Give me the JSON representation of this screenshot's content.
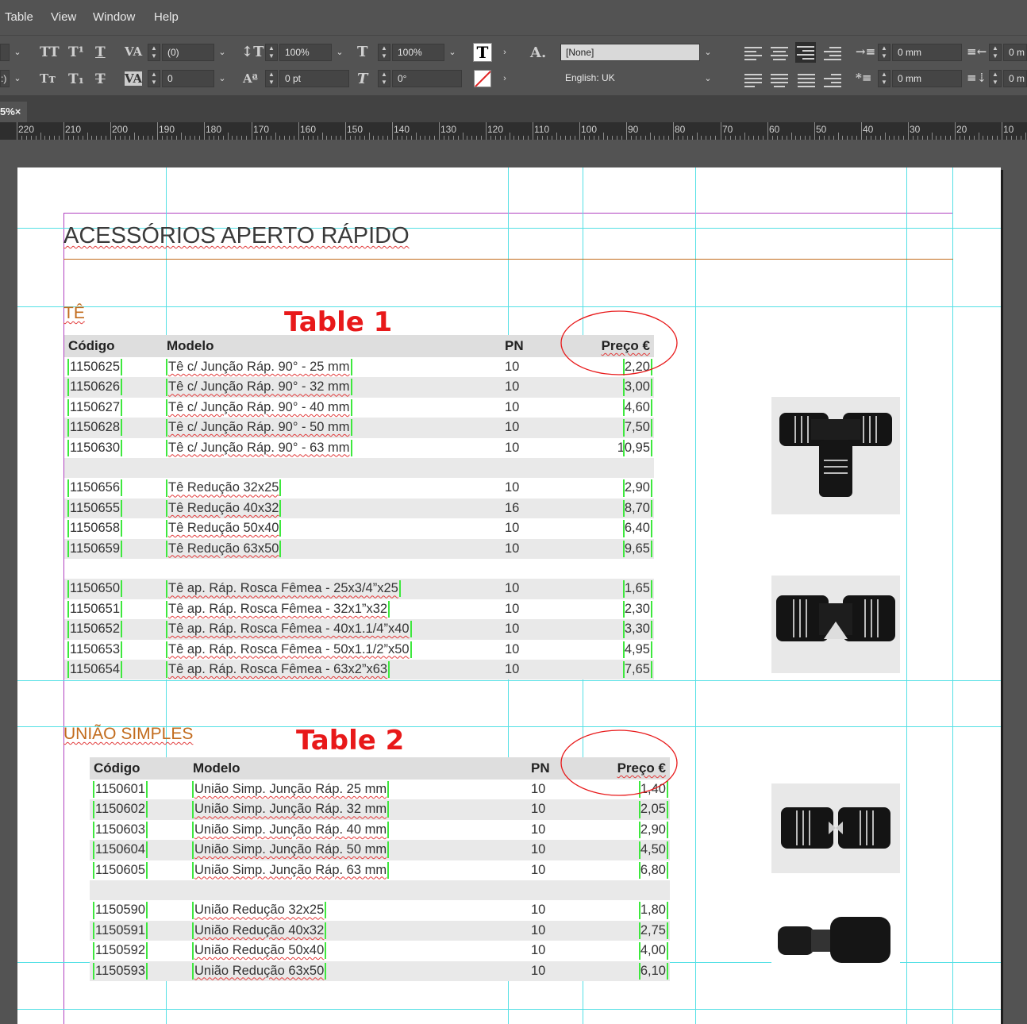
{
  "menu": [
    "Table",
    "View",
    "Window",
    "Help"
  ],
  "control_panel": {
    "tracking": "(0)",
    "kerning": "0",
    "vertical_scale": "100%",
    "horizontal_scale": "100%",
    "baseline_shift": "0 pt",
    "skew": "0°",
    "char_style": "[None]",
    "language": "English: UK",
    "left_indent": "0 mm",
    "first_line_indent": "0 mm",
    "right_indent_partial": "0 m",
    "last_line_indent_partial": "0 m"
  },
  "tab": {
    "label": "5%",
    "close": "×"
  },
  "ruler": [
    "220",
    "210",
    "200",
    "190",
    "180",
    "170",
    "160",
    "150",
    "140",
    "130",
    "120",
    "110",
    "100",
    "90",
    "80",
    "70",
    "60",
    "50",
    "40",
    "30",
    "20",
    "10"
  ],
  "document": {
    "title": "ACESSÓRIOS APERTO RÁPIDO",
    "section1": "TÊ",
    "section2": "UNIÃO SIMPLES",
    "annotation1": "Table 1",
    "annotation2": "Table 2",
    "headers": {
      "code": "Código",
      "model": "Modelo",
      "pn": "PN",
      "price": "Preço €"
    },
    "table1_groups": [
      [
        {
          "code": "1150625",
          "model": "Tê c/ Junção Ráp. 90° - 25 mm",
          "pn": "10",
          "price": "2,20"
        },
        {
          "code": "1150626",
          "model": "Tê c/ Junção Ráp. 90° - 32 mm",
          "pn": "10",
          "price": "3,00"
        },
        {
          "code": "1150627",
          "model": "Tê c/ Junção Ráp. 90° - 40 mm",
          "pn": "10",
          "price": "4,60"
        },
        {
          "code": "1150628",
          "model": "Tê c/ Junção Ráp. 90° - 50 mm",
          "pn": "10",
          "price": "7,50"
        },
        {
          "code": "1150630",
          "model": "Tê c/ Junção Ráp. 90° - 63 mm",
          "pn": "10",
          "price": "10,95"
        }
      ],
      [
        {
          "code": "1150656",
          "model": "Tê Redução 32x25",
          "pn": "10",
          "price": "2,90"
        },
        {
          "code": "1150655",
          "model": "Tê Redução 40x32",
          "pn": "16",
          "price": "8,70"
        },
        {
          "code": "1150658",
          "model": "Tê Redução 50x40",
          "pn": "10",
          "price": "6,40"
        },
        {
          "code": "1150659",
          "model": "Tê Redução 63x50",
          "pn": "10",
          "price": "9,65"
        }
      ],
      [
        {
          "code": "1150650",
          "model": "Tê ap. Ráp. Rosca Fêmea - 25x3/4”x25",
          "pn": "10",
          "price": "1,65"
        },
        {
          "code": "1150651",
          "model": "Tê ap. Ráp. Rosca Fêmea - 32x1”x32",
          "pn": "10",
          "price": "2,30"
        },
        {
          "code": "1150652",
          "model": "Tê ap. Ráp. Rosca Fêmea - 40x1.1/4”x40",
          "pn": "10",
          "price": "3,30"
        },
        {
          "code": "1150653",
          "model": "Tê ap. Ráp. Rosca Fêmea - 50x1.1/2”x50",
          "pn": "10",
          "price": "4,95"
        },
        {
          "code": "1150654",
          "model": "Tê ap. Ráp. Rosca Fêmea - 63x2”x63",
          "pn": "10",
          "price": "7,65"
        }
      ]
    ],
    "table2_groups": [
      [
        {
          "code": "1150601",
          "model": "União Simp. Junção Ráp. 25 mm",
          "pn": "10",
          "price": "1,40"
        },
        {
          "code": "1150602",
          "model": "União Simp. Junção Ráp. 32 mm",
          "pn": "10",
          "price": "2,05"
        },
        {
          "code": "1150603",
          "model": "União Simp. Junção Ráp. 40 mm",
          "pn": "10",
          "price": "2,90"
        },
        {
          "code": "1150604",
          "model": "União Simp. Junção Ráp. 50 mm",
          "pn": "10",
          "price": "4,50"
        },
        {
          "code": "1150605",
          "model": "União Simp. Junção Ráp. 63 mm",
          "pn": "10",
          "price": "6,80"
        }
      ],
      [
        {
          "code": "1150590",
          "model": "União Redução 32x25",
          "pn": "10",
          "price": "1,80"
        },
        {
          "code": "1150591",
          "model": "União Redução 40x32",
          "pn": "10",
          "price": "2,75"
        },
        {
          "code": "1150592",
          "model": "União Redução 50x40",
          "pn": "10",
          "price": "4,00"
        },
        {
          "code": "1150593",
          "model": "União Redução 63x50",
          "pn": "10",
          "price": "6,10"
        }
      ]
    ]
  },
  "colors": {
    "annotation": "#e8191a",
    "section": "#c26b1c",
    "guide": "#54e0e5",
    "margin": "#b040c0",
    "text_frame_bracket": "#3ee83e"
  }
}
